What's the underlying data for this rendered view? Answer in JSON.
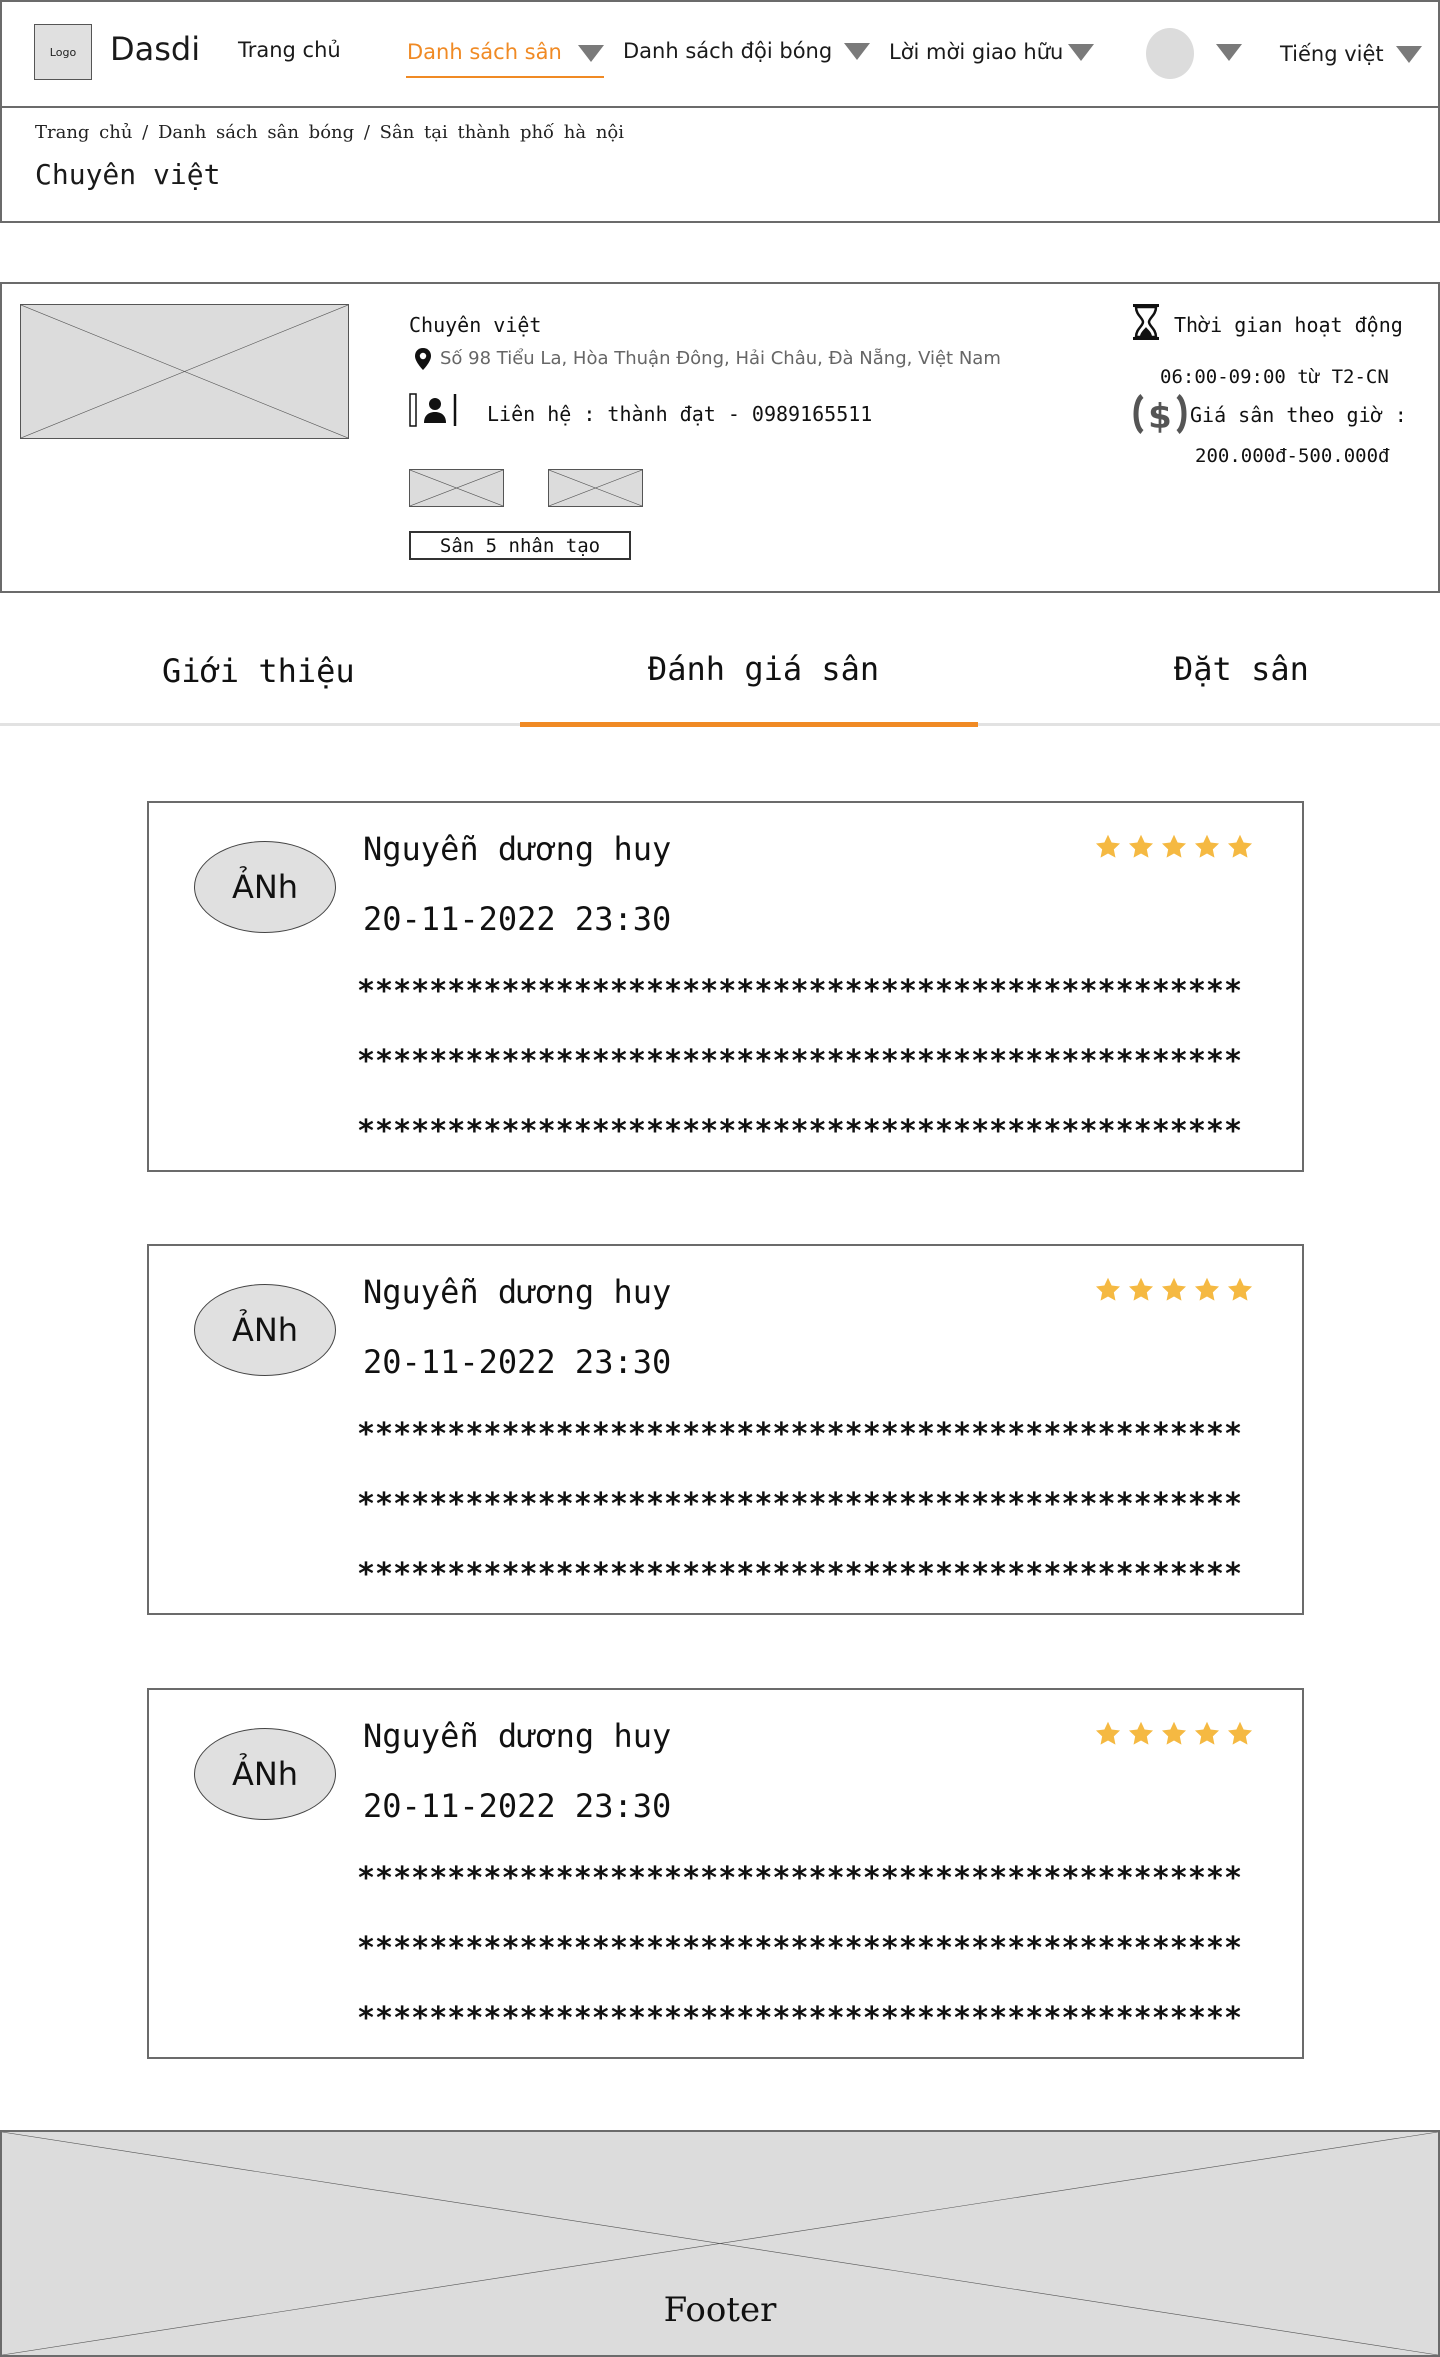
{
  "header": {
    "logo": "Logo",
    "brand": "Dasdi",
    "nav": {
      "home": "Trang chủ",
      "fields": "Danh sách sân",
      "teams": "Danh sách đội bóng",
      "invites": "Lời mời giao hữu",
      "language": "Tiếng việt"
    },
    "accent_color": "#f08a24"
  },
  "breadcrumb": "Trang chủ / Danh sách sân bóng / Sân tại thành phố hà nội",
  "page_title": "Chuyên việt",
  "venue": {
    "name": "Chuyên việt",
    "address": "Số 98 Tiểu La, Hòa Thuận Đông, Hải Châu, Đà Nẵng, Việt Nam",
    "contact": "Liên hệ : thành đạt - 0989165511",
    "field_type": "Sân 5 nhân tạo",
    "hours_label": "Thời gian hoạt động",
    "hours_value": "06:00-09:00 từ T2-CN",
    "price_label": "Giá sân theo giờ :",
    "price_value": "200.000đ-500.000đ"
  },
  "tabs": [
    "Giới thiệu",
    "Đánh giá sân",
    "Đặt sân"
  ],
  "active_tab": 1,
  "star_color": "#f5b942",
  "reviews": [
    {
      "avatar": "ẢNh",
      "name": "Nguyễn dương huy",
      "date": "20-11-2022 23:30",
      "rating": 5,
      "lines": [
        "*************************************************",
        "*************************************************",
        "*************************************************"
      ]
    },
    {
      "avatar": "ẢNh",
      "name": "Nguyễn dương huy",
      "date": "20-11-2022 23:30",
      "rating": 5,
      "lines": [
        "*************************************************",
        "*************************************************",
        "*************************************************"
      ]
    },
    {
      "avatar": "ẢNh",
      "name": "Nguyễn dương huy",
      "date": "20-11-2022 23:30",
      "rating": 5,
      "lines": [
        "*************************************************",
        "*************************************************",
        "*************************************************"
      ]
    }
  ],
  "footer": "Footer"
}
